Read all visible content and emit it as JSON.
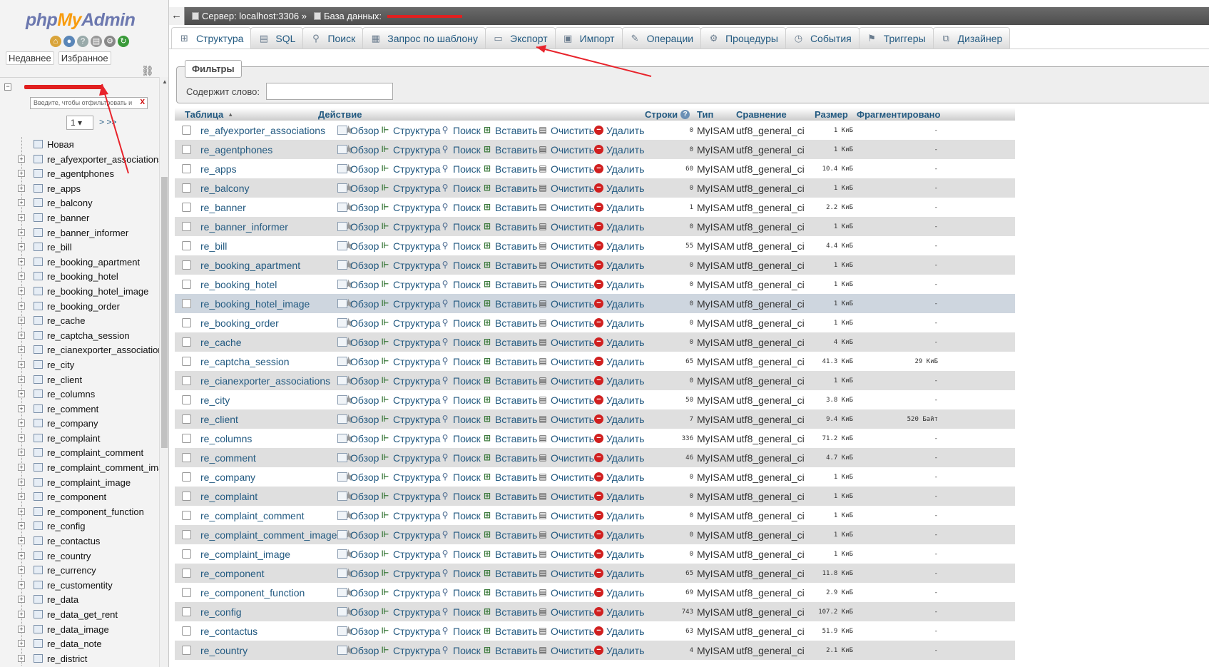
{
  "logo": {
    "part1": "php",
    "part2": "My",
    "part3": "Admin"
  },
  "sidebar": {
    "tab_recent": "Недавнее",
    "tab_favorites": "Избранное",
    "filter_placeholder": "Введите, чтобы отфильтровать и",
    "filter_clear": "X",
    "page_value": "1",
    "page_next": "> >>",
    "new_label": "Новая",
    "tables": [
      "re_afyexporter_associations",
      "re_agentphones",
      "re_apps",
      "re_balcony",
      "re_banner",
      "re_banner_informer",
      "re_bill",
      "re_booking_apartment",
      "re_booking_hotel",
      "re_booking_hotel_image",
      "re_booking_order",
      "re_cache",
      "re_captcha_session",
      "re_cianexporter_associations",
      "re_city",
      "re_client",
      "re_columns",
      "re_comment",
      "re_company",
      "re_complaint",
      "re_complaint_comment",
      "re_complaint_comment_image",
      "re_complaint_image",
      "re_component",
      "re_component_function",
      "re_config",
      "re_contactus",
      "re_country",
      "re_currency",
      "re_customentity",
      "re_data",
      "re_data_get_rent",
      "re_data_image",
      "re_data_note",
      "re_district"
    ]
  },
  "breadcrumb": {
    "server": "Сервер: localhost:3306 »",
    "database": "База данных:"
  },
  "tabs": [
    {
      "label": "Структура",
      "icon": "structure-icon"
    },
    {
      "label": "SQL",
      "icon": "sql-icon"
    },
    {
      "label": "Поиск",
      "icon": "search-icon"
    },
    {
      "label": "Запрос по шаблону",
      "icon": "query-icon"
    },
    {
      "label": "Экспорт",
      "icon": "export-icon"
    },
    {
      "label": "Импорт",
      "icon": "import-icon"
    },
    {
      "label": "Операции",
      "icon": "wrench-icon"
    },
    {
      "label": "Процедуры",
      "icon": "routines-icon"
    },
    {
      "label": "События",
      "icon": "events-icon"
    },
    {
      "label": "Триггеры",
      "icon": "triggers-icon"
    },
    {
      "label": "Дизайнер",
      "icon": "designer-icon"
    }
  ],
  "filters": {
    "legend": "Фильтры",
    "label": "Содержит слово:",
    "value": ""
  },
  "table": {
    "headers": {
      "table": "Таблица",
      "action": "Действие",
      "rows": "Строки",
      "type": "Тип",
      "collation": "Сравнение",
      "size": "Размер",
      "overhead": "Фрагментировано"
    },
    "actions": {
      "browse": "Обзор",
      "structure": "Структура",
      "search": "Поиск",
      "insert": "Вставить",
      "empty": "Очистить",
      "drop": "Удалить"
    },
    "rows": [
      {
        "name": "re_afyexporter_associations",
        "rows": "0",
        "type": "MyISAM",
        "collation": "utf8_general_ci",
        "size": "1 КиБ",
        "overhead": "-"
      },
      {
        "name": "re_agentphones",
        "rows": "0",
        "type": "MyISAM",
        "collation": "utf8_general_ci",
        "size": "1 КиБ",
        "overhead": "-"
      },
      {
        "name": "re_apps",
        "rows": "60",
        "type": "MyISAM",
        "collation": "utf8_general_ci",
        "size": "10.4 КиБ",
        "overhead": "-"
      },
      {
        "name": "re_balcony",
        "rows": "0",
        "type": "MyISAM",
        "collation": "utf8_general_ci",
        "size": "1 КиБ",
        "overhead": "-"
      },
      {
        "name": "re_banner",
        "rows": "1",
        "type": "MyISAM",
        "collation": "utf8_general_ci",
        "size": "2.2 КиБ",
        "overhead": "-"
      },
      {
        "name": "re_banner_informer",
        "rows": "0",
        "type": "MyISAM",
        "collation": "utf8_general_ci",
        "size": "1 КиБ",
        "overhead": "-"
      },
      {
        "name": "re_bill",
        "rows": "55",
        "type": "MyISAM",
        "collation": "utf8_general_ci",
        "size": "4.4 КиБ",
        "overhead": "-"
      },
      {
        "name": "re_booking_apartment",
        "rows": "0",
        "type": "MyISAM",
        "collation": "utf8_general_ci",
        "size": "1 КиБ",
        "overhead": "-"
      },
      {
        "name": "re_booking_hotel",
        "rows": "0",
        "type": "MyISAM",
        "collation": "utf8_general_ci",
        "size": "1 КиБ",
        "overhead": "-"
      },
      {
        "name": "re_booking_hotel_image",
        "rows": "0",
        "type": "MyISAM",
        "collation": "utf8_general_ci",
        "size": "1 КиБ",
        "overhead": "-"
      },
      {
        "name": "re_booking_order",
        "rows": "0",
        "type": "MyISAM",
        "collation": "utf8_general_ci",
        "size": "1 КиБ",
        "overhead": "-"
      },
      {
        "name": "re_cache",
        "rows": "0",
        "type": "MyISAM",
        "collation": "utf8_general_ci",
        "size": "4 КиБ",
        "overhead": "-"
      },
      {
        "name": "re_captcha_session",
        "rows": "65",
        "type": "MyISAM",
        "collation": "utf8_general_ci",
        "size": "41.3 КиБ",
        "overhead": "29 КиБ"
      },
      {
        "name": "re_cianexporter_associations",
        "rows": "0",
        "type": "MyISAM",
        "collation": "utf8_general_ci",
        "size": "1 КиБ",
        "overhead": "-"
      },
      {
        "name": "re_city",
        "rows": "50",
        "type": "MyISAM",
        "collation": "utf8_general_ci",
        "size": "3.8 КиБ",
        "overhead": "-"
      },
      {
        "name": "re_client",
        "rows": "7",
        "type": "MyISAM",
        "collation": "utf8_general_ci",
        "size": "9.4 КиБ",
        "overhead": "520 Байт"
      },
      {
        "name": "re_columns",
        "rows": "336",
        "type": "MyISAM",
        "collation": "utf8_general_ci",
        "size": "71.2 КиБ",
        "overhead": "-"
      },
      {
        "name": "re_comment",
        "rows": "46",
        "type": "MyISAM",
        "collation": "utf8_general_ci",
        "size": "4.7 КиБ",
        "overhead": "-"
      },
      {
        "name": "re_company",
        "rows": "0",
        "type": "MyISAM",
        "collation": "utf8_general_ci",
        "size": "1 КиБ",
        "overhead": "-"
      },
      {
        "name": "re_complaint",
        "rows": "0",
        "type": "MyISAM",
        "collation": "utf8_general_ci",
        "size": "1 КиБ",
        "overhead": "-"
      },
      {
        "name": "re_complaint_comment",
        "rows": "0",
        "type": "MyISAM",
        "collation": "utf8_general_ci",
        "size": "1 КиБ",
        "overhead": "-"
      },
      {
        "name": "re_complaint_comment_image",
        "rows": "0",
        "type": "MyISAM",
        "collation": "utf8_general_ci",
        "size": "1 КиБ",
        "overhead": "-"
      },
      {
        "name": "re_complaint_image",
        "rows": "0",
        "type": "MyISAM",
        "collation": "utf8_general_ci",
        "size": "1 КиБ",
        "overhead": "-"
      },
      {
        "name": "re_component",
        "rows": "65",
        "type": "MyISAM",
        "collation": "utf8_general_ci",
        "size": "11.8 КиБ",
        "overhead": "-"
      },
      {
        "name": "re_component_function",
        "rows": "69",
        "type": "MyISAM",
        "collation": "utf8_general_ci",
        "size": "2.9 КиБ",
        "overhead": "-"
      },
      {
        "name": "re_config",
        "rows": "743",
        "type": "MyISAM",
        "collation": "utf8_general_ci",
        "size": "107.2 КиБ",
        "overhead": "-"
      },
      {
        "name": "re_contactus",
        "rows": "63",
        "type": "MyISAM",
        "collation": "utf8_general_ci",
        "size": "51.9 КиБ",
        "overhead": "-"
      },
      {
        "name": "re_country",
        "rows": "4",
        "type": "MyISAM",
        "collation": "utf8_general_ci",
        "size": "2.1 КиБ",
        "overhead": "-"
      }
    ]
  }
}
